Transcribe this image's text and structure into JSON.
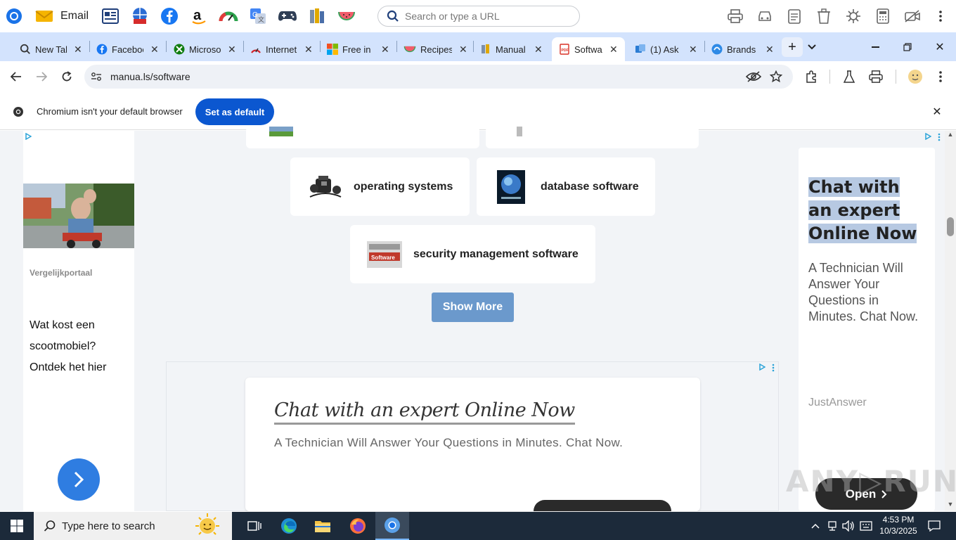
{
  "bookmarks": {
    "email_label": "Email",
    "search_placeholder": "Search or type a URL"
  },
  "tabs": [
    {
      "label": "New Tab"
    },
    {
      "label": "Facebook"
    },
    {
      "label": "Microsoft"
    },
    {
      "label": "Internet"
    },
    {
      "label": "Free in"
    },
    {
      "label": "Recipes"
    },
    {
      "label": "Manual"
    },
    {
      "label": "Software"
    },
    {
      "label": "(1) Ask"
    },
    {
      "label": "Brands"
    }
  ],
  "address": {
    "url": "manua.ls/software"
  },
  "infobar": {
    "message": "Chromium isn't your default browser",
    "button": "Set as default"
  },
  "content": {
    "categories": [
      {
        "label": "operating systems"
      },
      {
        "label": "database software"
      },
      {
        "label": "security management software"
      }
    ],
    "show_more": "Show More"
  },
  "left_ad": {
    "source": "Vergelijkportaal",
    "text": "Wat kost een scootmobiel? Ontdek het hier"
  },
  "right_ad": {
    "headline": "Chat with an expert Online Now",
    "body": "A Technician Will Answer Your Questions in Minutes. Chat Now.",
    "advertiser": "JustAnswer",
    "button": "Open"
  },
  "middle_ad": {
    "headline": "Chat with an expert Online Now",
    "body": "A Technician Will Answer Your Questions in Minutes. Chat Now."
  },
  "taskbar": {
    "search_placeholder": "Type here to search",
    "time": "4:53 PM",
    "date": "10/3/2025"
  },
  "colors": {
    "tab_strip": "#d3e3fd",
    "accent": "#0b57d0",
    "show_more": "#6b99cc",
    "page_bg": "#f2f4f7",
    "taskbar": "#1c2a3a"
  }
}
